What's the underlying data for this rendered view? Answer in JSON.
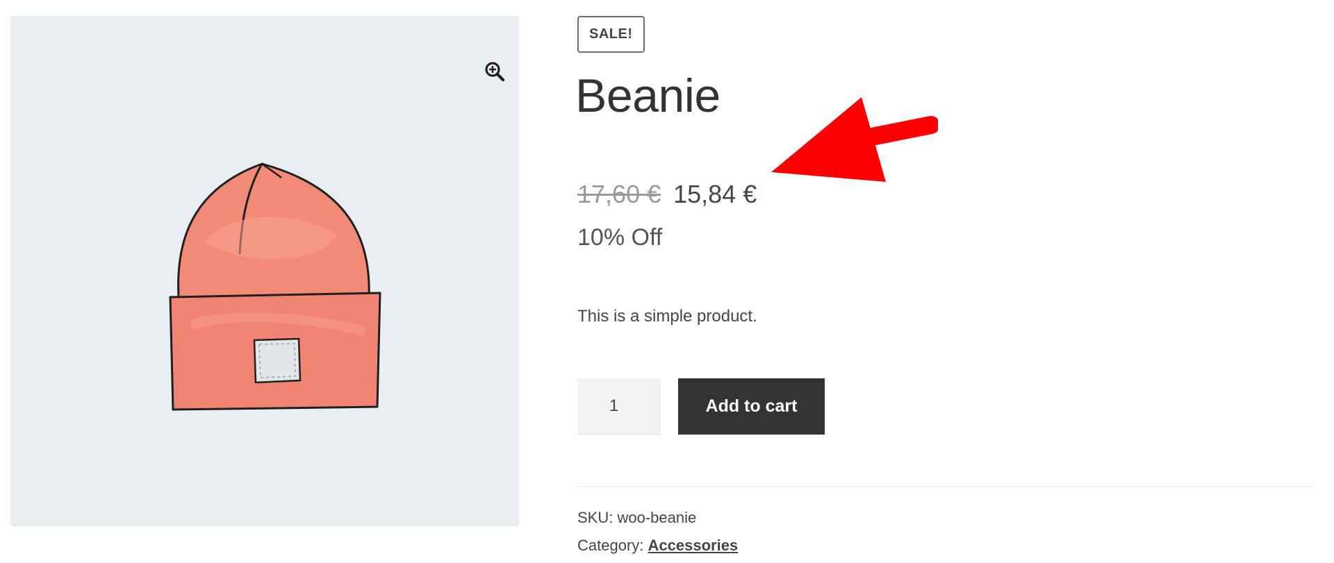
{
  "product": {
    "sale_badge": "SALE!",
    "title": "Beanie",
    "regular_price": "17,60 €",
    "sale_price": "15,84 €",
    "discount_text": "10% Off",
    "short_description": "This is a simple product.",
    "quantity": "1",
    "add_to_cart_label": "Add to cart",
    "sku_label": "SKU:",
    "sku_value": "woo-beanie",
    "category_label": "Category:",
    "category_value": "Accessories"
  },
  "gallery": {
    "zoom_icon": "zoom-in-icon",
    "image_subject": "beanie-hat"
  },
  "colors": {
    "button_bg": "#333333",
    "gallery_bg": "#e9eef2",
    "annotation_arrow": "#ff0000",
    "beanie": "#f28b76"
  }
}
